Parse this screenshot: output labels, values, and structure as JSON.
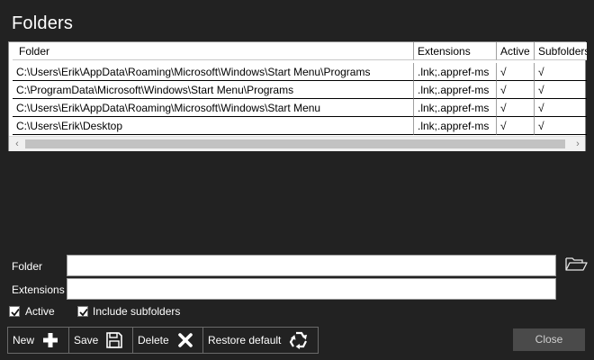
{
  "page": {
    "title": "Folders"
  },
  "grid": {
    "columns": [
      "Folder",
      "Extensions",
      "Active",
      "Subfolders"
    ],
    "rows": [
      [
        "C:\\Users\\Erik\\AppData\\Roaming\\Microsoft\\Windows\\Start Menu\\Programs",
        ".lnk;.appref-ms",
        "√",
        "√"
      ],
      [
        "C:\\ProgramData\\Microsoft\\Windows\\Start Menu\\Programs",
        ".lnk;.appref-ms",
        "√",
        "√"
      ],
      [
        "C:\\Users\\Erik\\AppData\\Roaming\\Microsoft\\Windows\\Start Menu",
        ".lnk;.appref-ms",
        "√",
        "√"
      ],
      [
        "C:\\Users\\Erik\\Desktop",
        ".lnk;.appref-ms",
        "√",
        "√"
      ]
    ]
  },
  "form": {
    "folder_label": "Folder",
    "folder_value": "",
    "extensions_label": "Extensions",
    "extensions_value": "",
    "active_label": "Active",
    "active_checked": true,
    "subfolders_label": "Include subfolders",
    "subfolders_checked": true,
    "browse_icon": "folder-open-icon"
  },
  "toolbar": {
    "new_label": "New",
    "new_icon": "plus-icon",
    "save_label": "Save",
    "save_icon": "floppy-icon",
    "delete_label": "Delete",
    "delete_icon": "x-icon",
    "restore_label": "Restore default",
    "restore_icon": "recycle-icon",
    "close_label": "Close"
  },
  "colors": {
    "background": "#222222",
    "grid_background": "#ffffff",
    "close_button": "#4a4a4a"
  }
}
